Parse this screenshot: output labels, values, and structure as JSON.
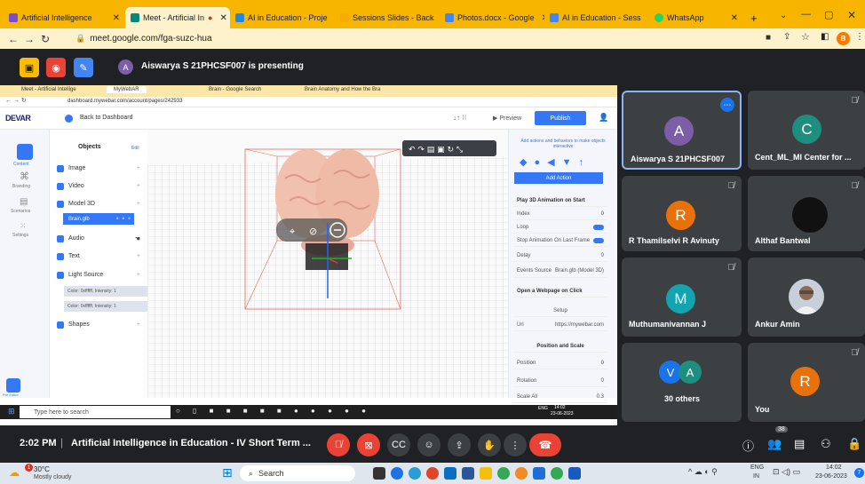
{
  "browser": {
    "tabs": [
      {
        "label": "Artificial Intelligence",
        "color": "#7b4bd6"
      },
      {
        "label": "Meet - Artificial In",
        "color": "#00897b"
      },
      {
        "label": "AI in Education - Proje",
        "color": "#1e88e5"
      },
      {
        "label": "Sessions Slides - Back",
        "color": "#f9ab00"
      },
      {
        "label": "Photos.docx - Google",
        "color": "#4285f4"
      },
      {
        "label": "AI in Education - Sess",
        "color": "#4285f4"
      },
      {
        "label": "WhatsApp",
        "color": "#25d366"
      }
    ],
    "new_tab": "+",
    "url": "meet.google.com/fga-suzc-hua",
    "profile_initial": "B"
  },
  "meet": {
    "presenting_initial": "A",
    "presenting_text": "Aiswarya S 21PHCSF007 is presenting",
    "meeting_time": "2:02 PM",
    "meeting_title": "Artificial Intelligence in Education - IV Short Term ...",
    "participant_count": "38"
  },
  "participants": [
    {
      "initial": "A",
      "name": "Aiswarya S 21PHCSF007",
      "color": "#7b5ea7"
    },
    {
      "initial": "C",
      "name": "Cent_ML_MI Center for ...",
      "color": "#1e8e7e"
    },
    {
      "initial": "R",
      "name": "R Thamilselvi R Avinuty",
      "color": "#e8710a"
    },
    {
      "initial": "",
      "name": "Althaf Bantwal",
      "color": "#111111"
    },
    {
      "initial": "M",
      "name": "Muthumanivannan J",
      "color": "#12a4af"
    },
    {
      "initial": "",
      "name": "Ankur Amin",
      "color": "#c8cfd8"
    },
    {
      "initial_a": "V",
      "initial_b": "A",
      "name": "30 others"
    },
    {
      "initial": "R",
      "name": "You",
      "color": "#e8710a"
    }
  ],
  "shared": {
    "tabs": [
      "Meet - Artificial Intellige",
      "MyWebAR",
      "Brain - Google Search",
      "Brain Anatomy and How the Bra"
    ],
    "url": "dashboard.mywebar.com/account/pages/242933",
    "logo": "DEVAR",
    "back_label": "Back to Dashboard",
    "preview": "Preview",
    "publish": "Publish",
    "objects_title": "Objects",
    "objects_edit": "Edit",
    "left_nav": [
      "Content",
      "Branding",
      "Scenarios",
      "Settings",
      "Pre Editor"
    ],
    "objects": [
      {
        "label": "Image"
      },
      {
        "label": "Video"
      },
      {
        "label": "Model 3D"
      },
      {
        "label": "Brain.glb"
      },
      {
        "label": "Audio"
      },
      {
        "label": "Text"
      },
      {
        "label": "Light Source"
      },
      {
        "label": "Color: 0xffffff, Intensity: 1"
      },
      {
        "label": "Color: 0xffffff, Intensity: 1"
      },
      {
        "label": "Shapes"
      }
    ],
    "right_panel": {
      "hint": "Add actions and behaviors to make objects interactive",
      "add_action": "Add Action",
      "play_anim": "Play 3D Animation on Start",
      "index_label": "Index",
      "index_value": "0",
      "loop_label": "Loop",
      "stop_label": "Stop Animation On Last Frame",
      "delay_label": "Delay",
      "delay_value": "0",
      "events_label": "Events Source",
      "events_value": "Brain.glb (Model 3D)",
      "webpage": "Open a Webpage on Click",
      "setup": "Setup",
      "url_label": "Url",
      "url_value": "https://mywebar.com",
      "pos_scale": "Position and Scale",
      "position": "Position",
      "rotation": "Rotation",
      "scale_all": "Scale All",
      "scale_value": "0.3",
      "zero": "0"
    },
    "win_search": "Type here to search",
    "win_time": "14:02",
    "win_date": "23-06-2023",
    "win_lang": "ENG"
  },
  "taskbar": {
    "weather_temp": "30°C",
    "weather_desc": "Mostly cloudy",
    "search": "Search",
    "lang": "ENG",
    "region": "IN",
    "time": "14:02",
    "date": "23-06-2023",
    "notif_count": "7",
    "weather_badge": "1"
  }
}
